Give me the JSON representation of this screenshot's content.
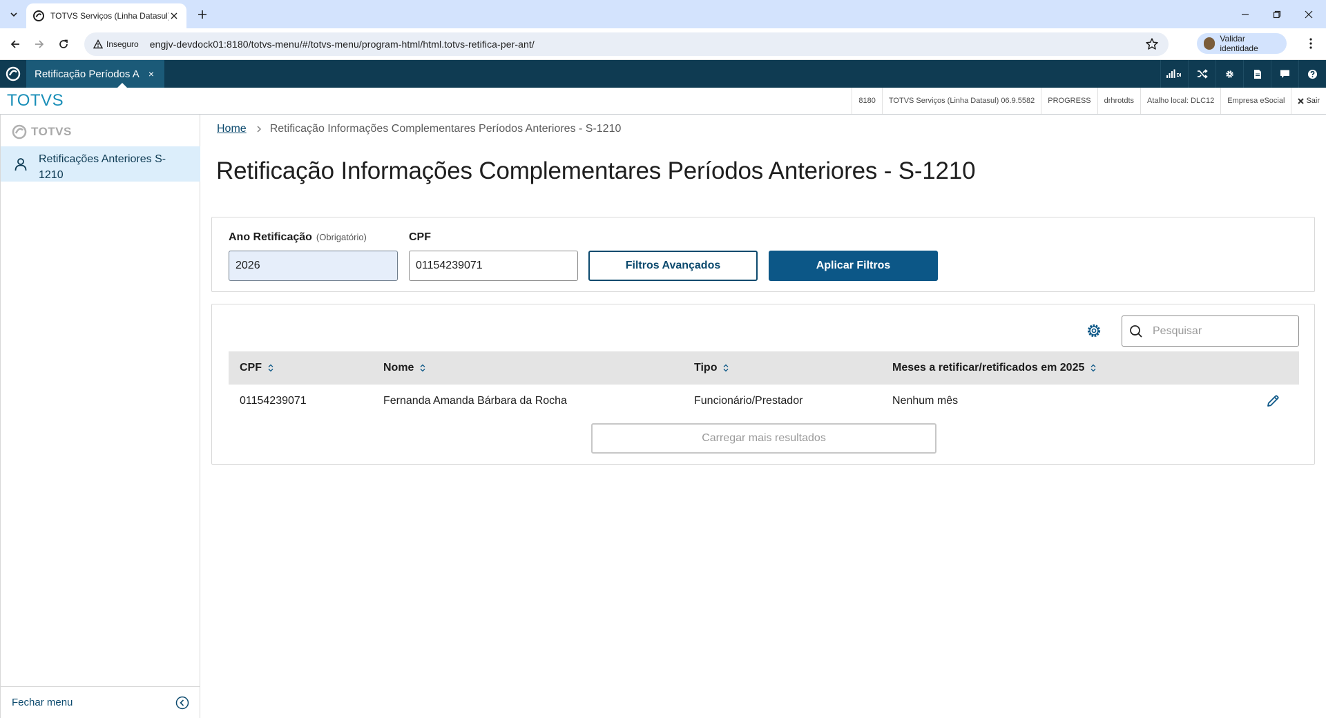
{
  "browser": {
    "tab_title": "TOTVS Serviços (Linha Datasul)",
    "security_label": "Inseguro",
    "url": "engjv-devdock01:8180/totvs-menu/#/totvs-menu/program-html/html.totvs-retifica-per-ant/",
    "identity_label": "Validar identidade"
  },
  "app_bar": {
    "tab_title": "Retificação Períodos A",
    "tab_close": "×",
    "icons": [
      "signal-di-icon",
      "shuffle-icon",
      "gear-icon",
      "document-icon",
      "chat-icon",
      "help-icon"
    ],
    "signal_badge": "DI"
  },
  "info_bar": {
    "brand": "TOTVS",
    "items": [
      "8180",
      "TOTVS Serviços (Linha Datasul) 06.9.5582",
      "PROGRESS",
      "drhrotdts",
      "Atalho local: DLC12",
      "Empresa eSocial"
    ],
    "logout": "Sair"
  },
  "sidebar": {
    "logo_text": "TOTVS",
    "active_item": "Retificações Anteriores S-1210",
    "footer_label": "Fechar menu"
  },
  "breadcrumb": {
    "home": "Home",
    "current": "Retificação Informações Complementares Períodos Anteriores - S-1210"
  },
  "page_title": "Retificação Informações Complementares Períodos Anteriores - S-1210",
  "filters": {
    "year_label": "Ano Retificação",
    "year_required": "(Obrigatório)",
    "year_value": "2026",
    "cpf_label": "CPF",
    "cpf_value": "01154239071",
    "advanced_button": "Filtros Avançados",
    "apply_button": "Aplicar Filtros"
  },
  "table": {
    "search_placeholder": "Pesquisar",
    "columns": [
      "CPF",
      "Nome",
      "Tipo",
      "Meses a retificar/retificados em 2025"
    ],
    "rows": [
      {
        "cpf": "01154239071",
        "nome": "Fernanda Amanda Bárbara da Rocha",
        "tipo": "Funcionário/Prestador",
        "meses": "Nenhum mês"
      }
    ],
    "load_more": "Carregar mais resultados"
  },
  "colors": {
    "brand_dark": "#0f3b52",
    "primary": "#0c5787",
    "brand_text": "#1a8fb8",
    "selected_bg": "#dceefb"
  }
}
